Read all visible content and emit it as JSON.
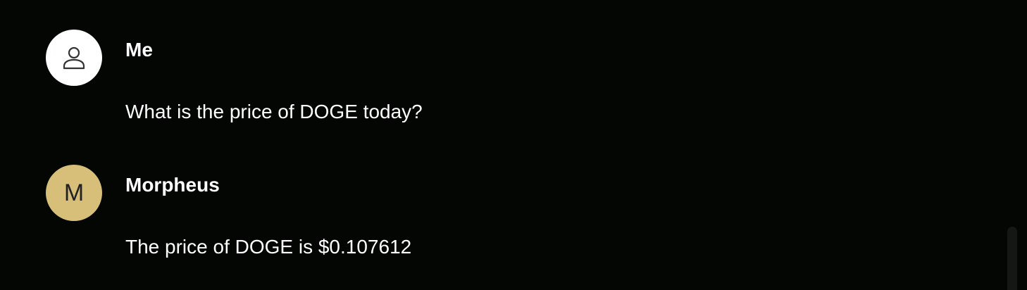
{
  "messages": [
    {
      "sender": "Me",
      "avatar_icon": "person-icon",
      "text": "What is the price of DOGE today?"
    },
    {
      "sender": "Morpheus",
      "avatar_letter": "M",
      "avatar_color": "#d7bf7a",
      "text": "The price of DOGE is $0.107612"
    }
  ]
}
